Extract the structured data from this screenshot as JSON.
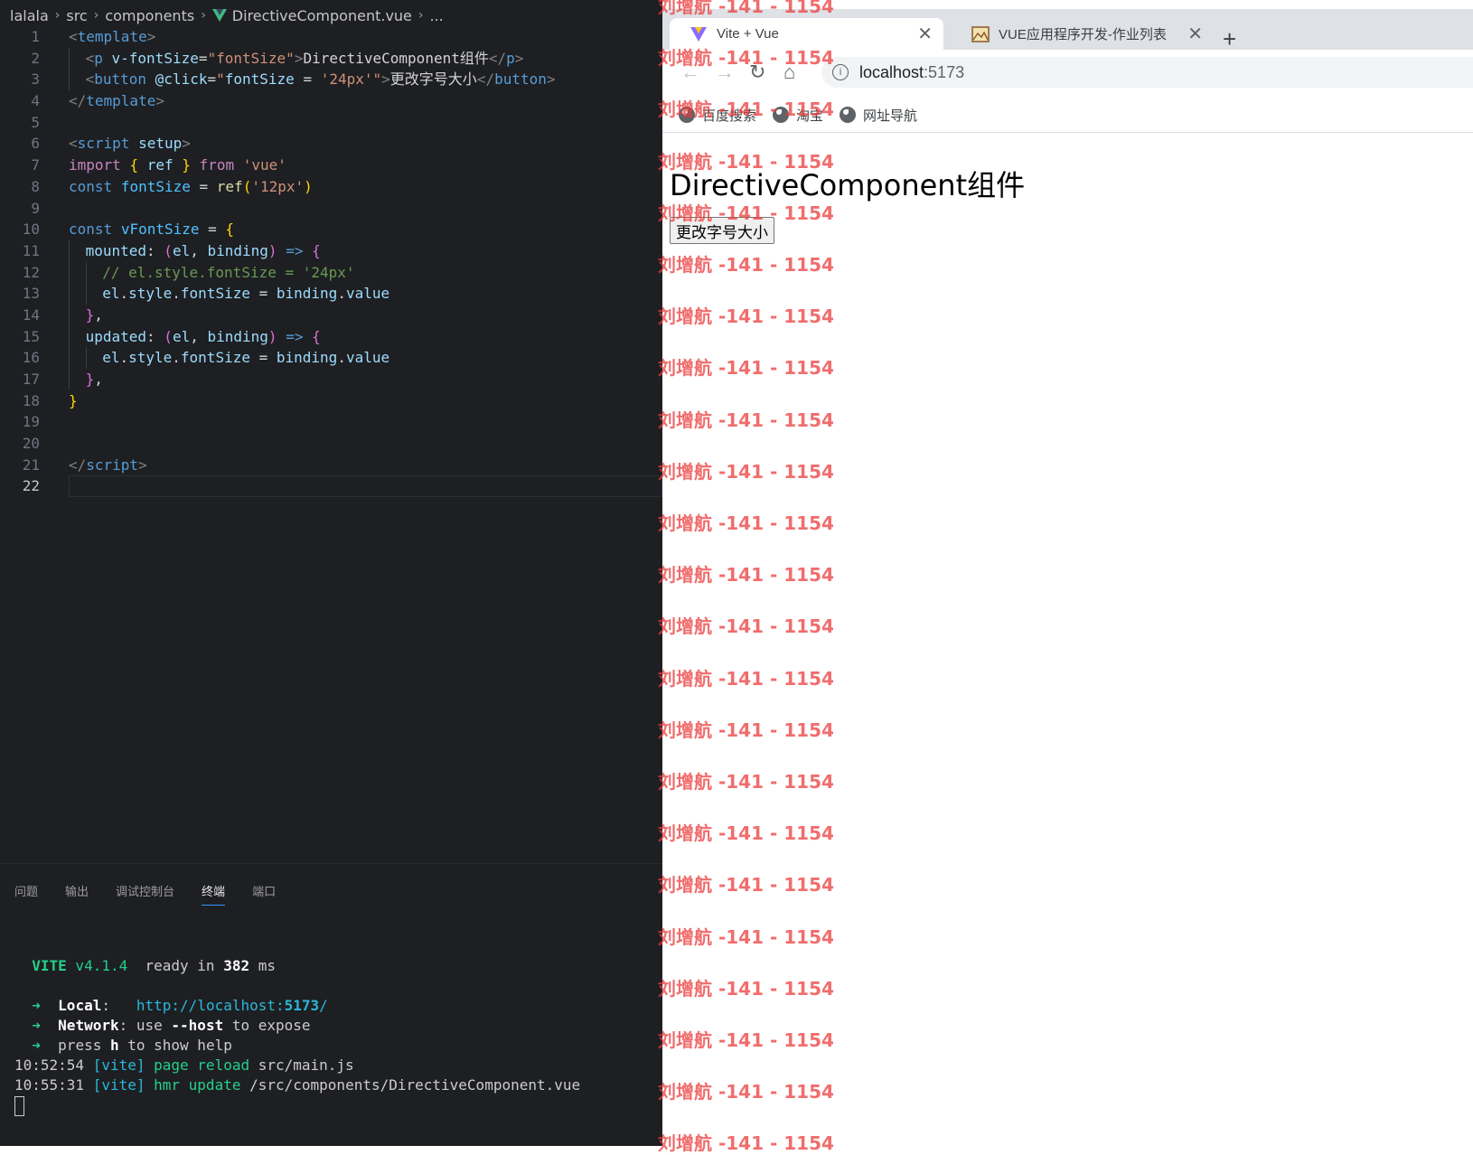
{
  "editor": {
    "breadcrumb": [
      "lalala",
      "src",
      "components",
      "DirectiveComponent.vue",
      "..."
    ],
    "lines": [
      {
        "n": "1",
        "tokens": [
          [
            "tag",
            "<"
          ],
          [
            "tn",
            "template"
          ],
          [
            "tag",
            ">"
          ]
        ],
        "indent": 0
      },
      {
        "n": "2",
        "tokens": [
          [
            "tag",
            "<"
          ],
          [
            "tn",
            "p"
          ],
          [
            "txt",
            " "
          ],
          [
            "attr",
            "v-fontSize"
          ],
          [
            "txt",
            "="
          ],
          [
            "str",
            "\"fontSize\""
          ],
          [
            "tag",
            ">"
          ],
          [
            "txt",
            "DirectiveComponent组件"
          ],
          [
            "tag",
            "</"
          ],
          [
            "tn",
            "p"
          ],
          [
            "tag",
            ">"
          ]
        ],
        "indent": 1
      },
      {
        "n": "3",
        "tokens": [
          [
            "tag",
            "<"
          ],
          [
            "tn",
            "button"
          ],
          [
            "txt",
            " "
          ],
          [
            "attr",
            "@click"
          ],
          [
            "txt",
            "="
          ],
          [
            "str",
            "\""
          ],
          [
            "var",
            "fontSize"
          ],
          [
            "txt",
            " = "
          ],
          [
            "str",
            "'24px'"
          ],
          [
            "str",
            "\""
          ],
          [
            "tag",
            ">"
          ],
          [
            "txt",
            "更改字号大小"
          ],
          [
            "tag",
            "</"
          ],
          [
            "tn",
            "button"
          ],
          [
            "tag",
            ">"
          ]
        ],
        "indent": 1
      },
      {
        "n": "4",
        "tokens": [
          [
            "tag",
            "</"
          ],
          [
            "tn",
            "template"
          ],
          [
            "tag",
            ">"
          ]
        ],
        "indent": 0
      },
      {
        "n": "5",
        "tokens": [],
        "indent": 0
      },
      {
        "n": "6",
        "tokens": [
          [
            "tag",
            "<"
          ],
          [
            "tn",
            "script"
          ],
          [
            "txt",
            " "
          ],
          [
            "attr",
            "setup"
          ],
          [
            "tag",
            ">"
          ]
        ],
        "indent": 0
      },
      {
        "n": "7",
        "tokens": [
          [
            "kw",
            "import"
          ],
          [
            "txt",
            " "
          ],
          [
            "br1",
            "{"
          ],
          [
            "txt",
            " "
          ],
          [
            "var",
            "ref"
          ],
          [
            "txt",
            " "
          ],
          [
            "br1",
            "}"
          ],
          [
            "txt",
            " "
          ],
          [
            "kw",
            "from"
          ],
          [
            "txt",
            " "
          ],
          [
            "str",
            "'vue'"
          ]
        ],
        "indent": 0
      },
      {
        "n": "8",
        "tokens": [
          [
            "kb",
            "const"
          ],
          [
            "txt",
            " "
          ],
          [
            "obj",
            "fontSize"
          ],
          [
            "txt",
            " = "
          ],
          [
            "fn",
            "ref"
          ],
          [
            "br1",
            "("
          ],
          [
            "str",
            "'12px'"
          ],
          [
            "br1",
            ")"
          ]
        ],
        "indent": 0
      },
      {
        "n": "9",
        "tokens": [],
        "indent": 0
      },
      {
        "n": "10",
        "tokens": [
          [
            "kb",
            "const"
          ],
          [
            "txt",
            " "
          ],
          [
            "obj",
            "vFontSize"
          ],
          [
            "txt",
            " = "
          ],
          [
            "br1",
            "{"
          ]
        ],
        "indent": 0
      },
      {
        "n": "11",
        "tokens": [
          [
            "var",
            "mounted"
          ],
          [
            "txt",
            ": "
          ],
          [
            "br2",
            "("
          ],
          [
            "var",
            "el"
          ],
          [
            "txt",
            ", "
          ],
          [
            "var",
            "binding"
          ],
          [
            "br2",
            ")"
          ],
          [
            "txt",
            " "
          ],
          [
            "kb",
            "=>"
          ],
          [
            "txt",
            " "
          ],
          [
            "br2",
            "{"
          ]
        ],
        "indent": 1
      },
      {
        "n": "12",
        "tokens": [
          [
            "cm",
            "// el.style.fontSize = '24px'"
          ]
        ],
        "indent": 2
      },
      {
        "n": "13",
        "tokens": [
          [
            "var",
            "el"
          ],
          [
            "txt",
            "."
          ],
          [
            "var",
            "style"
          ],
          [
            "txt",
            "."
          ],
          [
            "var",
            "fontSize"
          ],
          [
            "txt",
            " = "
          ],
          [
            "var",
            "binding"
          ],
          [
            "txt",
            "."
          ],
          [
            "var",
            "value"
          ]
        ],
        "indent": 2
      },
      {
        "n": "14",
        "tokens": [
          [
            "br2",
            "}"
          ],
          [
            "txt",
            ","
          ]
        ],
        "indent": 1
      },
      {
        "n": "15",
        "tokens": [
          [
            "var",
            "updated"
          ],
          [
            "txt",
            ": "
          ],
          [
            "br2",
            "("
          ],
          [
            "var",
            "el"
          ],
          [
            "txt",
            ", "
          ],
          [
            "var",
            "binding"
          ],
          [
            "br2",
            ")"
          ],
          [
            "txt",
            " "
          ],
          [
            "kb",
            "=>"
          ],
          [
            "txt",
            " "
          ],
          [
            "br2",
            "{"
          ]
        ],
        "indent": 1
      },
      {
        "n": "16",
        "tokens": [
          [
            "var",
            "el"
          ],
          [
            "txt",
            "."
          ],
          [
            "var",
            "style"
          ],
          [
            "txt",
            "."
          ],
          [
            "var",
            "fontSize"
          ],
          [
            "txt",
            " = "
          ],
          [
            "var",
            "binding"
          ],
          [
            "txt",
            "."
          ],
          [
            "var",
            "value"
          ]
        ],
        "indent": 2
      },
      {
        "n": "17",
        "tokens": [
          [
            "br2",
            "}"
          ],
          [
            "txt",
            ","
          ]
        ],
        "indent": 1
      },
      {
        "n": "18",
        "tokens": [
          [
            "br1",
            "}"
          ]
        ],
        "indent": 0
      },
      {
        "n": "19",
        "tokens": [],
        "indent": 0
      },
      {
        "n": "20",
        "tokens": [],
        "indent": 0
      },
      {
        "n": "21",
        "tokens": [
          [
            "tag",
            "</"
          ],
          [
            "tn",
            "script"
          ],
          [
            "tag",
            ">"
          ]
        ],
        "indent": 0
      },
      {
        "n": "22",
        "tokens": [],
        "indent": 0,
        "current": true
      }
    ]
  },
  "panel": {
    "tabs": [
      "问题",
      "输出",
      "调试控制台",
      "终端",
      "端口"
    ],
    "active_tab": "终端",
    "terminal": [
      [],
      [
        [
          "t",
          "  "
        ],
        [
          "gb",
          "VITE"
        ],
        [
          "g",
          " v4.1.4"
        ],
        [
          "t",
          "  ready in "
        ],
        [
          "w",
          "382"
        ],
        [
          "t",
          " ms"
        ]
      ],
      [],
      [
        [
          "t",
          "  "
        ],
        [
          "g",
          "➜"
        ],
        [
          "t",
          "  "
        ],
        [
          "w",
          "Local"
        ],
        [
          "t",
          ":   "
        ],
        [
          "c",
          "http://localhost:"
        ],
        [
          "cb",
          "5173"
        ],
        [
          "c",
          "/"
        ]
      ],
      [
        [
          "t",
          "  "
        ],
        [
          "g",
          "➜"
        ],
        [
          "t",
          "  "
        ],
        [
          "w",
          "Network"
        ],
        [
          "t",
          ": use "
        ],
        [
          "w",
          "--host"
        ],
        [
          "t",
          " to expose"
        ]
      ],
      [
        [
          "t",
          "  "
        ],
        [
          "g",
          "➜"
        ],
        [
          "t",
          "  press "
        ],
        [
          "w",
          "h"
        ],
        [
          "t",
          " to show help"
        ]
      ],
      [
        [
          "t",
          "10:52:54 "
        ],
        [
          "c",
          "[vite]"
        ],
        [
          "g",
          " page reload"
        ],
        [
          "t",
          " src/main.js"
        ]
      ],
      [
        [
          "t",
          "10:55:31 "
        ],
        [
          "c",
          "[vite]"
        ],
        [
          "g",
          " hmr update"
        ],
        [
          "t",
          " /src/components/DirectiveComponent.vue"
        ]
      ]
    ]
  },
  "browser": {
    "tab1_title": "Vite + Vue",
    "tab2_title": "VUE应用程序开发-作业列表",
    "url_host": "localhost",
    "url_port": ":5173",
    "bookmarks": [
      "百度搜索",
      "淘宝",
      "网址导航"
    ],
    "page_title": "DirectiveComponent组件",
    "button_label": "更改字号大小"
  },
  "watermark": "刘增航 -141 - 1154",
  "colors": {
    "editor_bg": "#1e1f22",
    "vue_green": "#41b883",
    "watermark": "#eb3c3c"
  }
}
